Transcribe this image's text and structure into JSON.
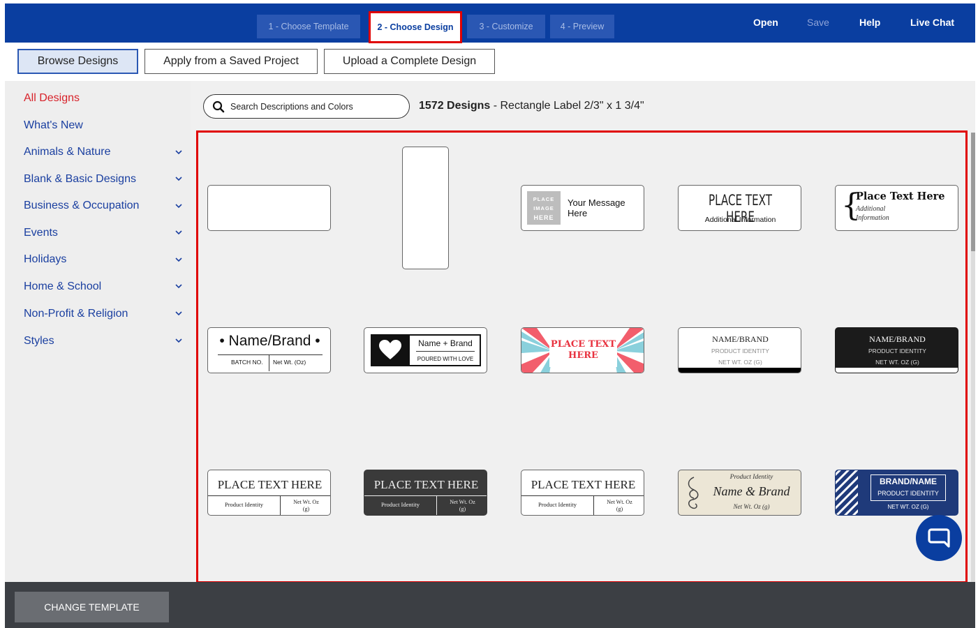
{
  "topbar": {
    "steps": [
      {
        "label": "1 - Choose Template"
      },
      {
        "label": "2 - Choose Design"
      },
      {
        "label": "3 - Customize"
      },
      {
        "label": "4 - Preview"
      }
    ],
    "links": {
      "open": "Open",
      "save": "Save",
      "help": "Help",
      "live_chat": "Live Chat"
    }
  },
  "tabs": {
    "browse": "Browse Designs",
    "apply": "Apply from a Saved Project",
    "upload": "Upload a Complete Design"
  },
  "sidebar": {
    "items": [
      {
        "label": "All Designs",
        "active": true
      },
      {
        "label": "What's New"
      },
      {
        "label": "Animals & Nature"
      },
      {
        "label": "Blank & Basic Designs"
      },
      {
        "label": "Business & Occupation"
      },
      {
        "label": "Events"
      },
      {
        "label": "Holidays"
      },
      {
        "label": "Home & School"
      },
      {
        "label": "Non-Profit & Religion"
      },
      {
        "label": "Styles"
      }
    ]
  },
  "search": {
    "placeholder": "Search Descriptions and Colors"
  },
  "results": {
    "count": "1572 Designs",
    "template": " - Rectangle Label 2/3\" x 1 3/4\""
  },
  "designs": {
    "d3": {
      "img1": "PLACE",
      "img2": "IMAGE",
      "img3": "HERE",
      "msg1": "Your Message",
      "msg2": "Here"
    },
    "d4": {
      "title": "PLACE TEXT HERE",
      "sub": "Additional Information"
    },
    "d5": {
      "title": "Place Text Here",
      "sub1": "Additional",
      "sub2": "Information"
    },
    "d6": {
      "title": "Name/Brand",
      "batch": "BATCH NO.",
      "net": "Net Wt. (Oz)"
    },
    "d7": {
      "title": "Name + Brand",
      "sub": "POURED WITH LOVE"
    },
    "d8": {
      "title1": "PLACE TEXT",
      "title2": "HERE"
    },
    "d9": {
      "title": "NAME/BRAND",
      "sub": "PRODUCT IDENTITY",
      "net": "NET WT. OZ (G)"
    },
    "d10": {
      "title": "NAME/BRAND",
      "sub": "PRODUCT IDENTITY",
      "net": "NET WT. OZ (G)"
    },
    "d11": {
      "title": "PLACE TEXT HERE",
      "left": "Product Identity",
      "right1": "Net Wt. Oz",
      "right2": "(g)"
    },
    "d12": {
      "title": "PLACE TEXT HERE",
      "left": "Product Identity",
      "right1": "Net Wt. Oz",
      "right2": "(g)"
    },
    "d13": {
      "title": "PLACE TEXT HERE",
      "left": "Product Identity",
      "right1": "Net Wt. Oz",
      "right2": "(g)"
    },
    "d14": {
      "top": "Product Identity",
      "title": "Name & Brand",
      "net": "Net Wt. Oz (g)"
    },
    "d15": {
      "title": "BRAND/NAME",
      "sub": "PRODUCT IDENTITY",
      "net": "NET WT. OZ (G)"
    }
  },
  "bottom": {
    "change_template": "CHANGE TEMPLATE"
  },
  "colors": {
    "brand": "#0a3ea0",
    "highlight": "#e00000",
    "active_nav": "#d8222a",
    "link": "#1a3fa0"
  }
}
